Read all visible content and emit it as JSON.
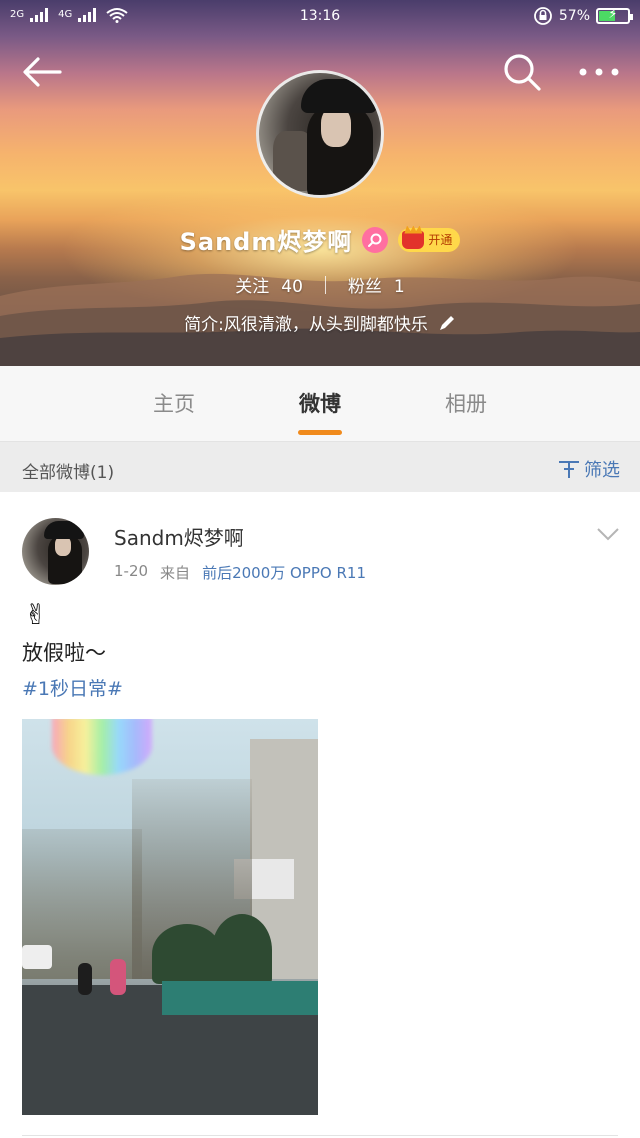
{
  "status_bar": {
    "signal_left": "2G",
    "signal_right": "4G",
    "time": "13:16",
    "battery": "57%",
    "battery_level": 0.57
  },
  "header": {
    "profile_name": "Sandm烬梦啊",
    "vip_label": "开通",
    "following_label": "关注",
    "following_count": "40",
    "followers_label": "粉丝",
    "followers_count": "1",
    "bio": "简介:风很清澈，从头到脚都快乐"
  },
  "tabs": [
    {
      "label": "主页"
    },
    {
      "label": "微博"
    },
    {
      "label": "相册"
    }
  ],
  "filter": {
    "title": "全部微博(1)",
    "button_label": "筛选"
  },
  "post": {
    "user": "Sandm烬梦啊",
    "date": "1-20",
    "source_prefix": "来自",
    "device": "前后2000万 OPPO R11",
    "emoji": "✌",
    "text": "放假啦～",
    "tag": "#1秒日常#"
  },
  "colors": {
    "accent_orange": "#f08a1c",
    "link_blue": "#4a78b5",
    "vip_yellow": "#ffd84a",
    "badge_pink": "#ff6fa0"
  }
}
